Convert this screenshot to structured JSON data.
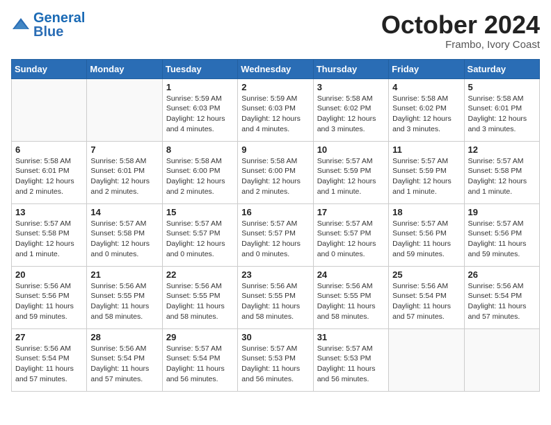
{
  "header": {
    "logo_general": "General",
    "logo_blue": "Blue",
    "month_title": "October 2024",
    "subtitle": "Frambo, Ivory Coast"
  },
  "weekdays": [
    "Sunday",
    "Monday",
    "Tuesday",
    "Wednesday",
    "Thursday",
    "Friday",
    "Saturday"
  ],
  "weeks": [
    [
      {
        "day": "",
        "info": ""
      },
      {
        "day": "",
        "info": ""
      },
      {
        "day": "1",
        "info": "Sunrise: 5:59 AM\nSunset: 6:03 PM\nDaylight: 12 hours and 4 minutes."
      },
      {
        "day": "2",
        "info": "Sunrise: 5:59 AM\nSunset: 6:03 PM\nDaylight: 12 hours and 4 minutes."
      },
      {
        "day": "3",
        "info": "Sunrise: 5:58 AM\nSunset: 6:02 PM\nDaylight: 12 hours and 3 minutes."
      },
      {
        "day": "4",
        "info": "Sunrise: 5:58 AM\nSunset: 6:02 PM\nDaylight: 12 hours and 3 minutes."
      },
      {
        "day": "5",
        "info": "Sunrise: 5:58 AM\nSunset: 6:01 PM\nDaylight: 12 hours and 3 minutes."
      }
    ],
    [
      {
        "day": "6",
        "info": "Sunrise: 5:58 AM\nSunset: 6:01 PM\nDaylight: 12 hours and 2 minutes."
      },
      {
        "day": "7",
        "info": "Sunrise: 5:58 AM\nSunset: 6:01 PM\nDaylight: 12 hours and 2 minutes."
      },
      {
        "day": "8",
        "info": "Sunrise: 5:58 AM\nSunset: 6:00 PM\nDaylight: 12 hours and 2 minutes."
      },
      {
        "day": "9",
        "info": "Sunrise: 5:58 AM\nSunset: 6:00 PM\nDaylight: 12 hours and 2 minutes."
      },
      {
        "day": "10",
        "info": "Sunrise: 5:57 AM\nSunset: 5:59 PM\nDaylight: 12 hours and 1 minute."
      },
      {
        "day": "11",
        "info": "Sunrise: 5:57 AM\nSunset: 5:59 PM\nDaylight: 12 hours and 1 minute."
      },
      {
        "day": "12",
        "info": "Sunrise: 5:57 AM\nSunset: 5:58 PM\nDaylight: 12 hours and 1 minute."
      }
    ],
    [
      {
        "day": "13",
        "info": "Sunrise: 5:57 AM\nSunset: 5:58 PM\nDaylight: 12 hours and 1 minute."
      },
      {
        "day": "14",
        "info": "Sunrise: 5:57 AM\nSunset: 5:58 PM\nDaylight: 12 hours and 0 minutes."
      },
      {
        "day": "15",
        "info": "Sunrise: 5:57 AM\nSunset: 5:57 PM\nDaylight: 12 hours and 0 minutes."
      },
      {
        "day": "16",
        "info": "Sunrise: 5:57 AM\nSunset: 5:57 PM\nDaylight: 12 hours and 0 minutes."
      },
      {
        "day": "17",
        "info": "Sunrise: 5:57 AM\nSunset: 5:57 PM\nDaylight: 12 hours and 0 minutes."
      },
      {
        "day": "18",
        "info": "Sunrise: 5:57 AM\nSunset: 5:56 PM\nDaylight: 11 hours and 59 minutes."
      },
      {
        "day": "19",
        "info": "Sunrise: 5:57 AM\nSunset: 5:56 PM\nDaylight: 11 hours and 59 minutes."
      }
    ],
    [
      {
        "day": "20",
        "info": "Sunrise: 5:56 AM\nSunset: 5:56 PM\nDaylight: 11 hours and 59 minutes."
      },
      {
        "day": "21",
        "info": "Sunrise: 5:56 AM\nSunset: 5:55 PM\nDaylight: 11 hours and 58 minutes."
      },
      {
        "day": "22",
        "info": "Sunrise: 5:56 AM\nSunset: 5:55 PM\nDaylight: 11 hours and 58 minutes."
      },
      {
        "day": "23",
        "info": "Sunrise: 5:56 AM\nSunset: 5:55 PM\nDaylight: 11 hours and 58 minutes."
      },
      {
        "day": "24",
        "info": "Sunrise: 5:56 AM\nSunset: 5:55 PM\nDaylight: 11 hours and 58 minutes."
      },
      {
        "day": "25",
        "info": "Sunrise: 5:56 AM\nSunset: 5:54 PM\nDaylight: 11 hours and 57 minutes."
      },
      {
        "day": "26",
        "info": "Sunrise: 5:56 AM\nSunset: 5:54 PM\nDaylight: 11 hours and 57 minutes."
      }
    ],
    [
      {
        "day": "27",
        "info": "Sunrise: 5:56 AM\nSunset: 5:54 PM\nDaylight: 11 hours and 57 minutes."
      },
      {
        "day": "28",
        "info": "Sunrise: 5:56 AM\nSunset: 5:54 PM\nDaylight: 11 hours and 57 minutes."
      },
      {
        "day": "29",
        "info": "Sunrise: 5:57 AM\nSunset: 5:54 PM\nDaylight: 11 hours and 56 minutes."
      },
      {
        "day": "30",
        "info": "Sunrise: 5:57 AM\nSunset: 5:53 PM\nDaylight: 11 hours and 56 minutes."
      },
      {
        "day": "31",
        "info": "Sunrise: 5:57 AM\nSunset: 5:53 PM\nDaylight: 11 hours and 56 minutes."
      },
      {
        "day": "",
        "info": ""
      },
      {
        "day": "",
        "info": ""
      }
    ]
  ]
}
